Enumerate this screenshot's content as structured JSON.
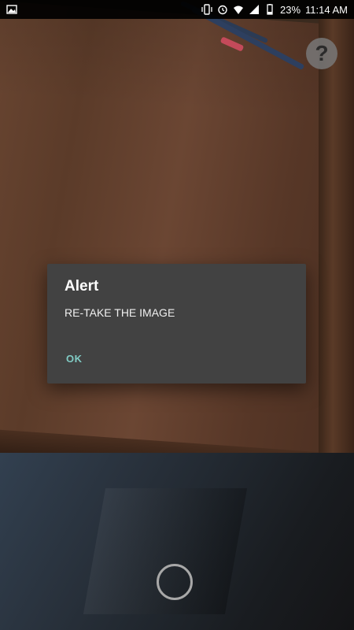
{
  "status_bar": {
    "battery_percent": "23%",
    "time": "11:14 AM",
    "icons": [
      "image-icon",
      "vibrate-icon",
      "alarm-icon",
      "wifi-icon",
      "signal-icon",
      "battery-icon"
    ]
  },
  "help_button": {
    "label": "?",
    "icon": "help-icon"
  },
  "dialog": {
    "title": "Alert",
    "message": "RE-TAKE THE IMAGE",
    "ok_label": "OK"
  },
  "colors": {
    "dialog_bg": "#424242",
    "accent": "#80cbc4"
  }
}
